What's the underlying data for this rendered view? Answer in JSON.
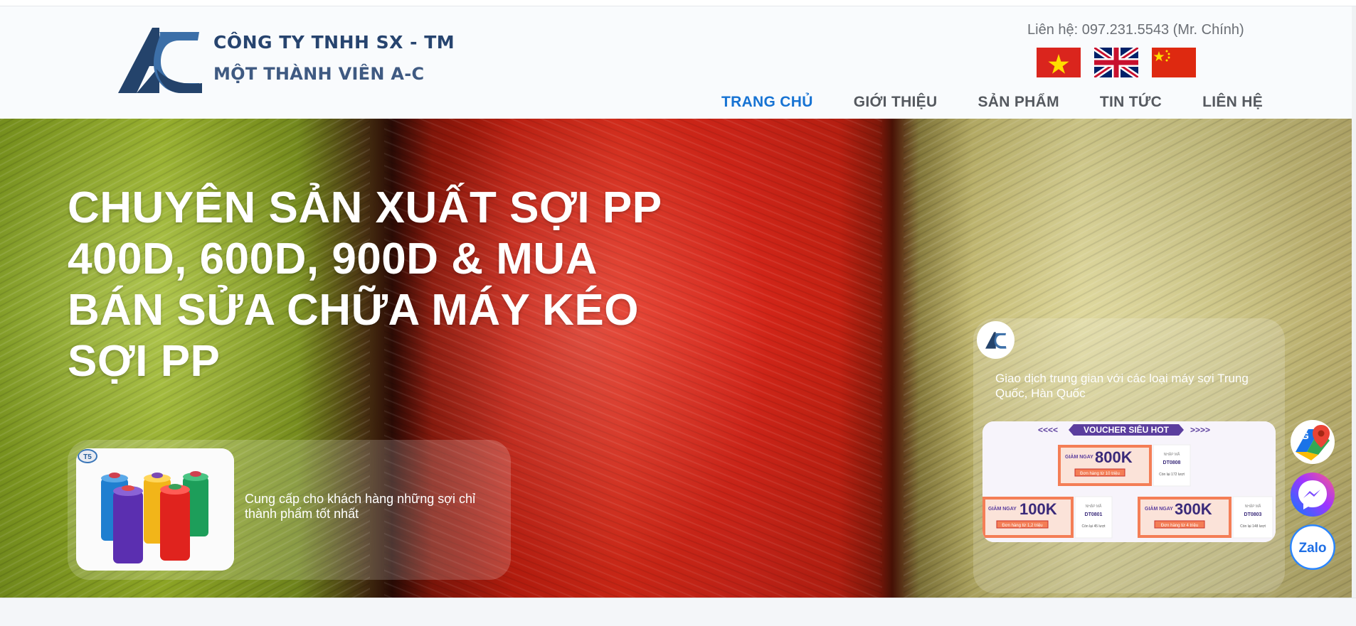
{
  "header": {
    "company_line1": "CÔNG TY TNHH SX - TM",
    "company_line2": "MỘT THÀNH VIÊN A-C",
    "contact": "Liên hệ: 097.231.5543 (Mr. Chính)",
    "flags": [
      "vietnam-flag",
      "uk-flag",
      "china-flag"
    ]
  },
  "nav": {
    "items": [
      {
        "label": "TRANG CHỦ",
        "active": true
      },
      {
        "label": "GIỚI THIỆU",
        "active": false
      },
      {
        "label": "SẢN PHẨM",
        "active": false
      },
      {
        "label": "TIN TỨC",
        "active": false
      },
      {
        "label": "LIÊN HỆ",
        "active": false
      }
    ]
  },
  "hero": {
    "headline_1": "CHUYÊN SẢN XUẤT SỢI PP",
    "headline_2": "400D, 600D, 900D & MUA",
    "headline_3": "BÁN SỬA CHỮA MÁY KÉO",
    "headline_4": "SỢI PP",
    "card_left_text": "Cung cấp cho khách hàng những sợi chỉ thành phẩm tốt nhất",
    "card_right_text": "Giao dịch trung gian với các loại máy sợi Trung Quốc, Hàn Quốc",
    "voucher": {
      "banner": "VOUCHER SIÊU HOT",
      "arrows_left": "<<<<",
      "arrows_right": ">>>>",
      "giam_ngay": "GIẢM NGAY",
      "nhap_ma": "NHẬP MÃ",
      "offers": [
        {
          "amount": "800K",
          "condition": "Đơn hàng từ 10 triệu",
          "code": "DT0808",
          "remaining": "Còn lại 172 lượt"
        },
        {
          "amount": "100K",
          "condition": "Đơn hàng từ 1,2 triệu",
          "code": "DT0801",
          "remaining": "Còn lại 45 lượt"
        },
        {
          "amount": "300K",
          "condition": "Đơn hàng từ 4 triệu",
          "code": "DT0803",
          "remaining": "Còn lại 148 lượt"
        }
      ]
    }
  },
  "floating": {
    "zalo_label": "Zalo",
    "maps_icon": "google-maps-icon",
    "messenger_icon": "messenger-icon"
  },
  "colors": {
    "nav_active": "#1773d3",
    "brand_navy": "#27446f",
    "voucher_orange": "#f47e56",
    "voucher_purple": "#5b3e9e"
  }
}
